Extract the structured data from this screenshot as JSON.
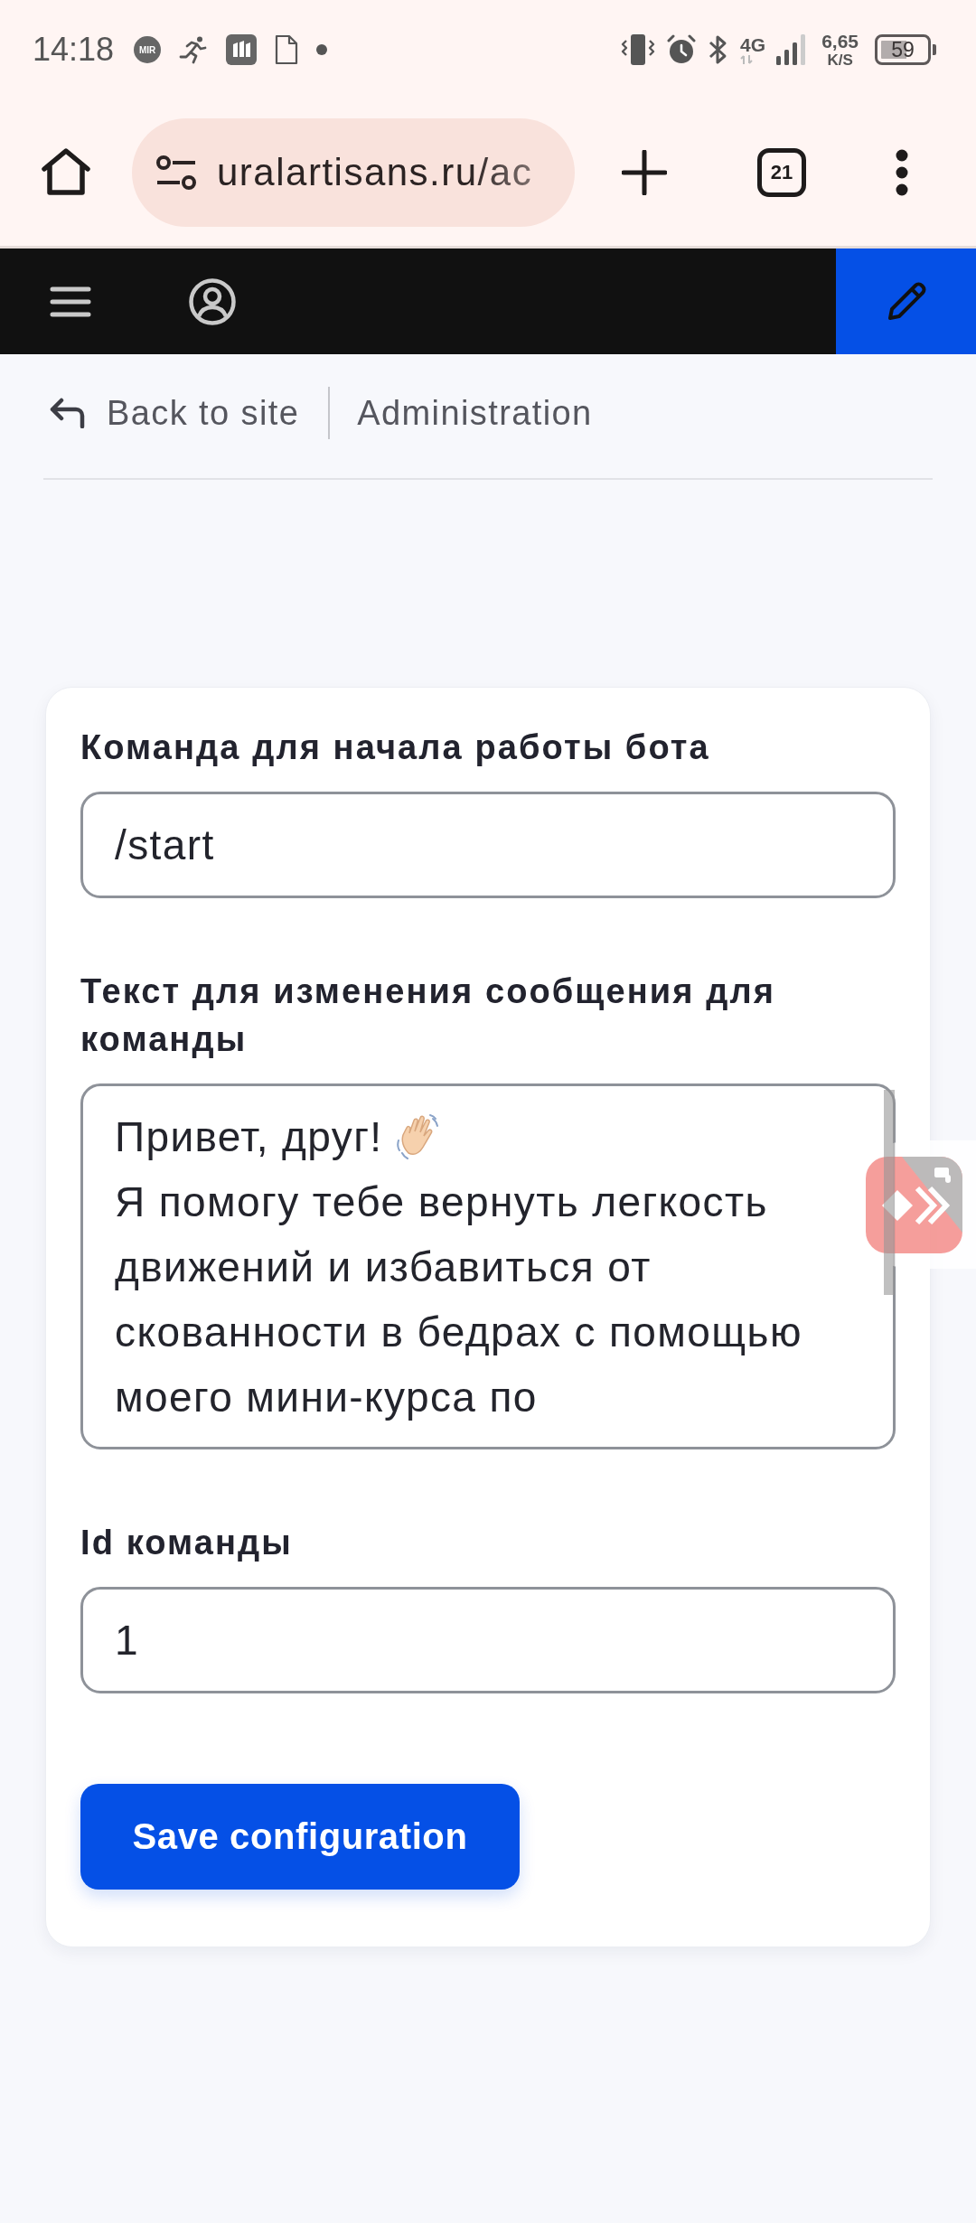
{
  "status_bar": {
    "time": "14:18",
    "payment_badge": "MIR",
    "network_type": "4G",
    "speed_value": "6,65",
    "speed_unit": "K/S",
    "battery": "59"
  },
  "browser": {
    "url": "uralartisans.ru/ac",
    "tab_count": "21"
  },
  "breadcrumbs": {
    "back_link": "Back to site",
    "section": "Administration"
  },
  "form": {
    "fields": [
      {
        "kind": "input",
        "label": "Команда для начала работы бота",
        "value": "/start"
      },
      {
        "kind": "textarea",
        "label": "Текст для изменения сообщения для команды",
        "greeting": "Привет, друг!",
        "value": "Я помогу тебе вернуть легкость движений и избавиться от скованности в бедрах с помощью моего мини-курса по"
      },
      {
        "kind": "input",
        "label": "Id команды",
        "value": "1"
      }
    ],
    "submit": "Save configuration"
  }
}
